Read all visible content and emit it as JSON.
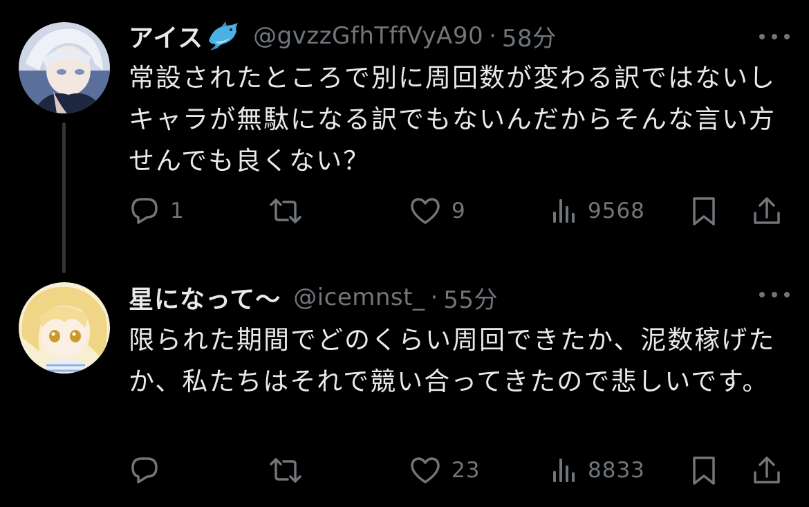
{
  "colors": {
    "background": "#000000",
    "text_primary": "#e7e9ea",
    "text_secondary": "#71767b",
    "thread_line": "#333639"
  },
  "tweets": [
    {
      "display_name": "アイス",
      "name_emoji": "dolphin-emoji",
      "handle": "@gvzzGfhTffVyA90",
      "separator": "·",
      "time": "58分",
      "text": "常設されたところで別に周回数が変わる訳ではないしキャラが無駄になる訳でもないんだからそんな言い方せんでも良くない？",
      "stats": {
        "replies": "1",
        "retweets": "",
        "likes": "9",
        "views": "9568"
      }
    },
    {
      "display_name": "星になって〜",
      "handle": "@icemnst_",
      "separator": "·",
      "time": "55分",
      "text": "限られた期間でどのくらい周回できたか、泥数稼げたか、私たちはそれで競い合ってきたので悲しいです。",
      "stats": {
        "replies": "",
        "retweets": "",
        "likes": "23",
        "views": "8833"
      }
    }
  ],
  "icons": {
    "reply": "reply-icon",
    "retweet": "retweet-icon",
    "like": "heart-icon",
    "views": "views-icon",
    "bookmark": "bookmark-icon",
    "share": "share-icon",
    "more": "more-icon"
  }
}
